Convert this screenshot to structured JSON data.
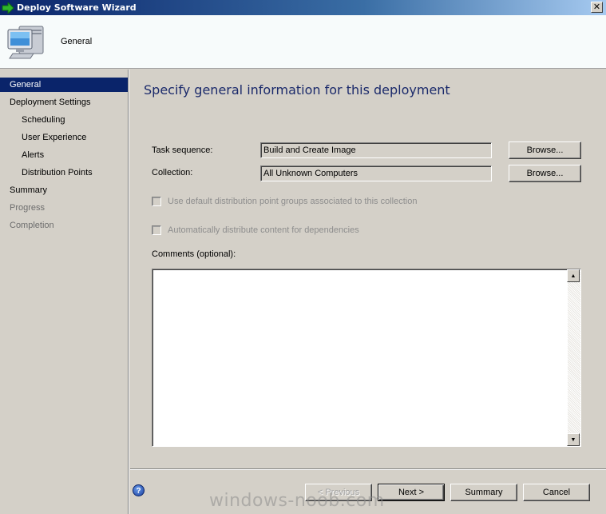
{
  "window": {
    "title": "Deploy Software Wizard",
    "close_label": "✕"
  },
  "banner": {
    "title": "General",
    "icon": "computer-icon"
  },
  "nav": {
    "items": [
      {
        "label": "General",
        "state": "selected"
      },
      {
        "label": "Deployment Settings",
        "state": "normal"
      },
      {
        "label": "Scheduling",
        "state": "normal"
      },
      {
        "label": "User Experience",
        "state": "normal"
      },
      {
        "label": "Alerts",
        "state": "normal"
      },
      {
        "label": "Distribution Points",
        "state": "normal"
      },
      {
        "label": "Summary",
        "state": "normal"
      },
      {
        "label": "Progress",
        "state": "disabled"
      },
      {
        "label": "Completion",
        "state": "disabled"
      }
    ]
  },
  "content": {
    "heading": "Specify general information for this deployment",
    "task_sequence": {
      "label": "Task sequence:",
      "value": "Build and Create Image",
      "browse_label": "Browse..."
    },
    "collection": {
      "label": "Collection:",
      "value": "All Unknown Computers",
      "browse_label": "Browse..."
    },
    "checkbox_default_groups": {
      "label": "Use default distribution point groups associated to this collection",
      "checked": false
    },
    "checkbox_dependencies": {
      "label": "Automatically distribute content for dependencies",
      "checked": false
    },
    "comments": {
      "label": "Comments (optional):",
      "value": ""
    }
  },
  "footer": {
    "previous_label": "< Previous",
    "next_label": "Next >",
    "summary_label": "Summary",
    "cancel_label": "Cancel",
    "help_label": "?",
    "watermark": "windows-noob.com"
  },
  "colors": {
    "accent": "#0a246a",
    "heading": "#1b2a6b",
    "dialog_bg": "#d4d0c8"
  }
}
